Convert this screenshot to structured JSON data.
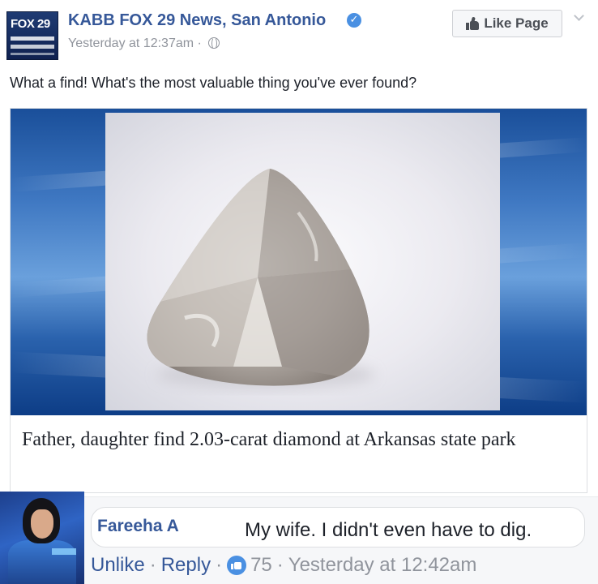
{
  "post": {
    "page_name": "KABB FOX 29 News, San Antonio",
    "timestamp": "Yesterday at 12:37am",
    "separator": "·",
    "like_page_label": "Like Page",
    "text": "What a find! What's the most valuable thing you've ever found?",
    "logo": {
      "brand": "FOX 29",
      "icon": "station-logo"
    }
  },
  "link_preview": {
    "title": "Father, daughter find 2.03-carat diamond at Arkansas state park",
    "image_icon": "diamond-photo"
  },
  "comment": {
    "author": "Fareeha A",
    "text": "My wife. I didn't even have to dig.",
    "unlike_label": "Unlike",
    "reply_label": "Reply",
    "like_count": "75",
    "time": "Yesterday at 12:42am",
    "separator": "·"
  },
  "colors": {
    "link_blue": "#365899",
    "meta_gray": "#90949c",
    "badge_blue": "#4a90e2"
  }
}
